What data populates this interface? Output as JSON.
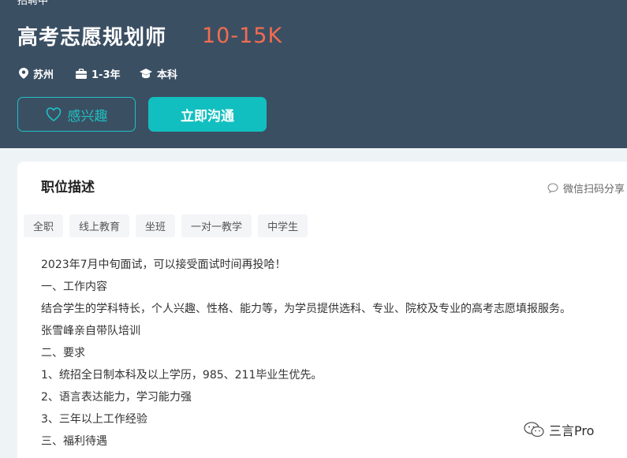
{
  "header": {
    "status": "招聘中",
    "job_title": "高考志愿规划师",
    "salary": "10-15K",
    "meta": {
      "city": "苏州",
      "experience": "1-3年",
      "education": "本科"
    },
    "interest_button": "感兴趣",
    "chat_button": "立即沟通"
  },
  "card": {
    "section_title": "职位描述",
    "share_label": "微信扫码分享",
    "tags": [
      "全职",
      "线上教育",
      "坐班",
      "一对一教学",
      "中学生"
    ],
    "description": [
      "2023年7月中旬面试，可以接受面试时间再投哈！",
      "一、工作内容",
      "结合学生的学科特长，个人兴趣、性格、能力等，为学员提供选科、专业、院校及专业的高考志愿填报服务。",
      "张雪峰亲自带队培训",
      "二、要求",
      "1、统招全日制本科及以上学历，985、211毕业生优先。",
      "2、语言表达能力，学习能力强",
      "3、三年以上工作经验",
      "三、福利待遇"
    ]
  },
  "watermark": {
    "text": "三言Pro"
  },
  "colors": {
    "banner": "#3b4f63",
    "salary": "#f26d4f",
    "accent": "#12bfc0"
  }
}
